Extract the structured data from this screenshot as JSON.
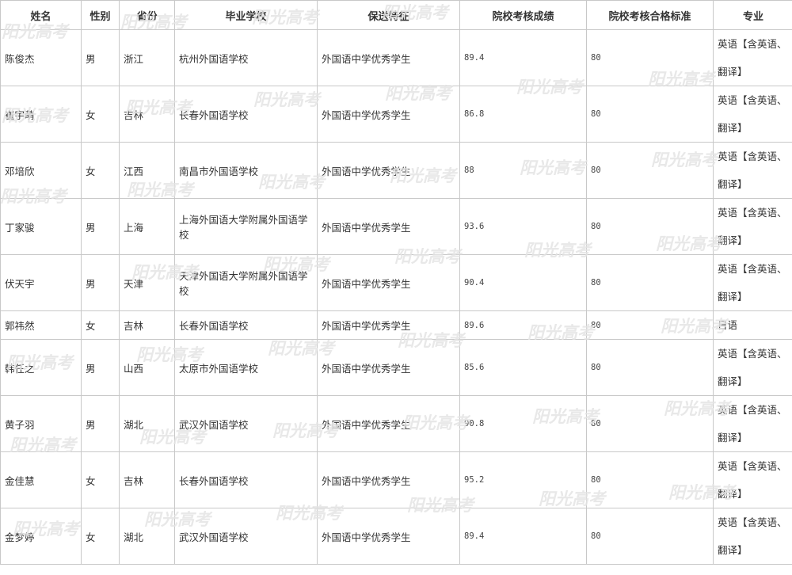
{
  "table": {
    "headers": [
      "姓名",
      "性别",
      "省份",
      "毕业学校",
      "保送特征",
      "院校考核成绩",
      "院校考核合格标准",
      "专业"
    ],
    "rows": [
      {
        "name": "陈俊杰",
        "gender": "男",
        "province": "浙江",
        "school": "杭州外国语学校",
        "feature": "外国语中学优秀学生",
        "score": "89.4",
        "standard": "80",
        "major": "英语【含英语、翻译】"
      },
      {
        "name": "崔宇萌",
        "gender": "女",
        "province": "吉林",
        "school": "长春外国语学校",
        "feature": "外国语中学优秀学生",
        "score": "86.8",
        "standard": "80",
        "major": "英语【含英语、翻译】"
      },
      {
        "name": "邓培欣",
        "gender": "女",
        "province": "江西",
        "school": "南昌市外国语学校",
        "feature": "外国语中学优秀学生",
        "score": "88",
        "standard": "80",
        "major": "英语【含英语、翻译】"
      },
      {
        "name": "丁家骏",
        "gender": "男",
        "province": "上海",
        "school": "上海外国语大学附属外国语学校",
        "feature": "外国语中学优秀学生",
        "score": "93.6",
        "standard": "80",
        "major": "英语【含英语、翻译】"
      },
      {
        "name": "伏天宇",
        "gender": "男",
        "province": "天津",
        "school": "天津外国语大学附属外国语学校",
        "feature": "外国语中学优秀学生",
        "score": "90.4",
        "standard": "80",
        "major": "英语【含英语、翻译】"
      },
      {
        "name": "郭祎然",
        "gender": "女",
        "province": "吉林",
        "school": "长春外国语学校",
        "feature": "外国语中学优秀学生",
        "score": "89.6",
        "standard": "80",
        "major": "日语"
      },
      {
        "name": "韩任之",
        "gender": "男",
        "province": "山西",
        "school": "太原市外国语学校",
        "feature": "外国语中学优秀学生",
        "score": "85.6",
        "standard": "80",
        "major": "英语【含英语、翻译】"
      },
      {
        "name": "黄子羽",
        "gender": "男",
        "province": "湖北",
        "school": "武汉外国语学校",
        "feature": "外国语中学优秀学生",
        "score": "90.8",
        "standard": "80",
        "major": "英语【含英语、翻译】"
      },
      {
        "name": "金佳慧",
        "gender": "女",
        "province": "吉林",
        "school": "长春外国语学校",
        "feature": "外国语中学优秀学生",
        "score": "95.2",
        "standard": "80",
        "major": "英语【含英语、翻译】"
      },
      {
        "name": "金梦婷",
        "gender": "女",
        "province": "湖北",
        "school": "武汉外国语学校",
        "feature": "外国语中学优秀学生",
        "score": "89.4",
        "standard": "80",
        "major": "英语【含英语、翻译】"
      }
    ]
  },
  "watermark": {
    "text": "阳光高考"
  }
}
